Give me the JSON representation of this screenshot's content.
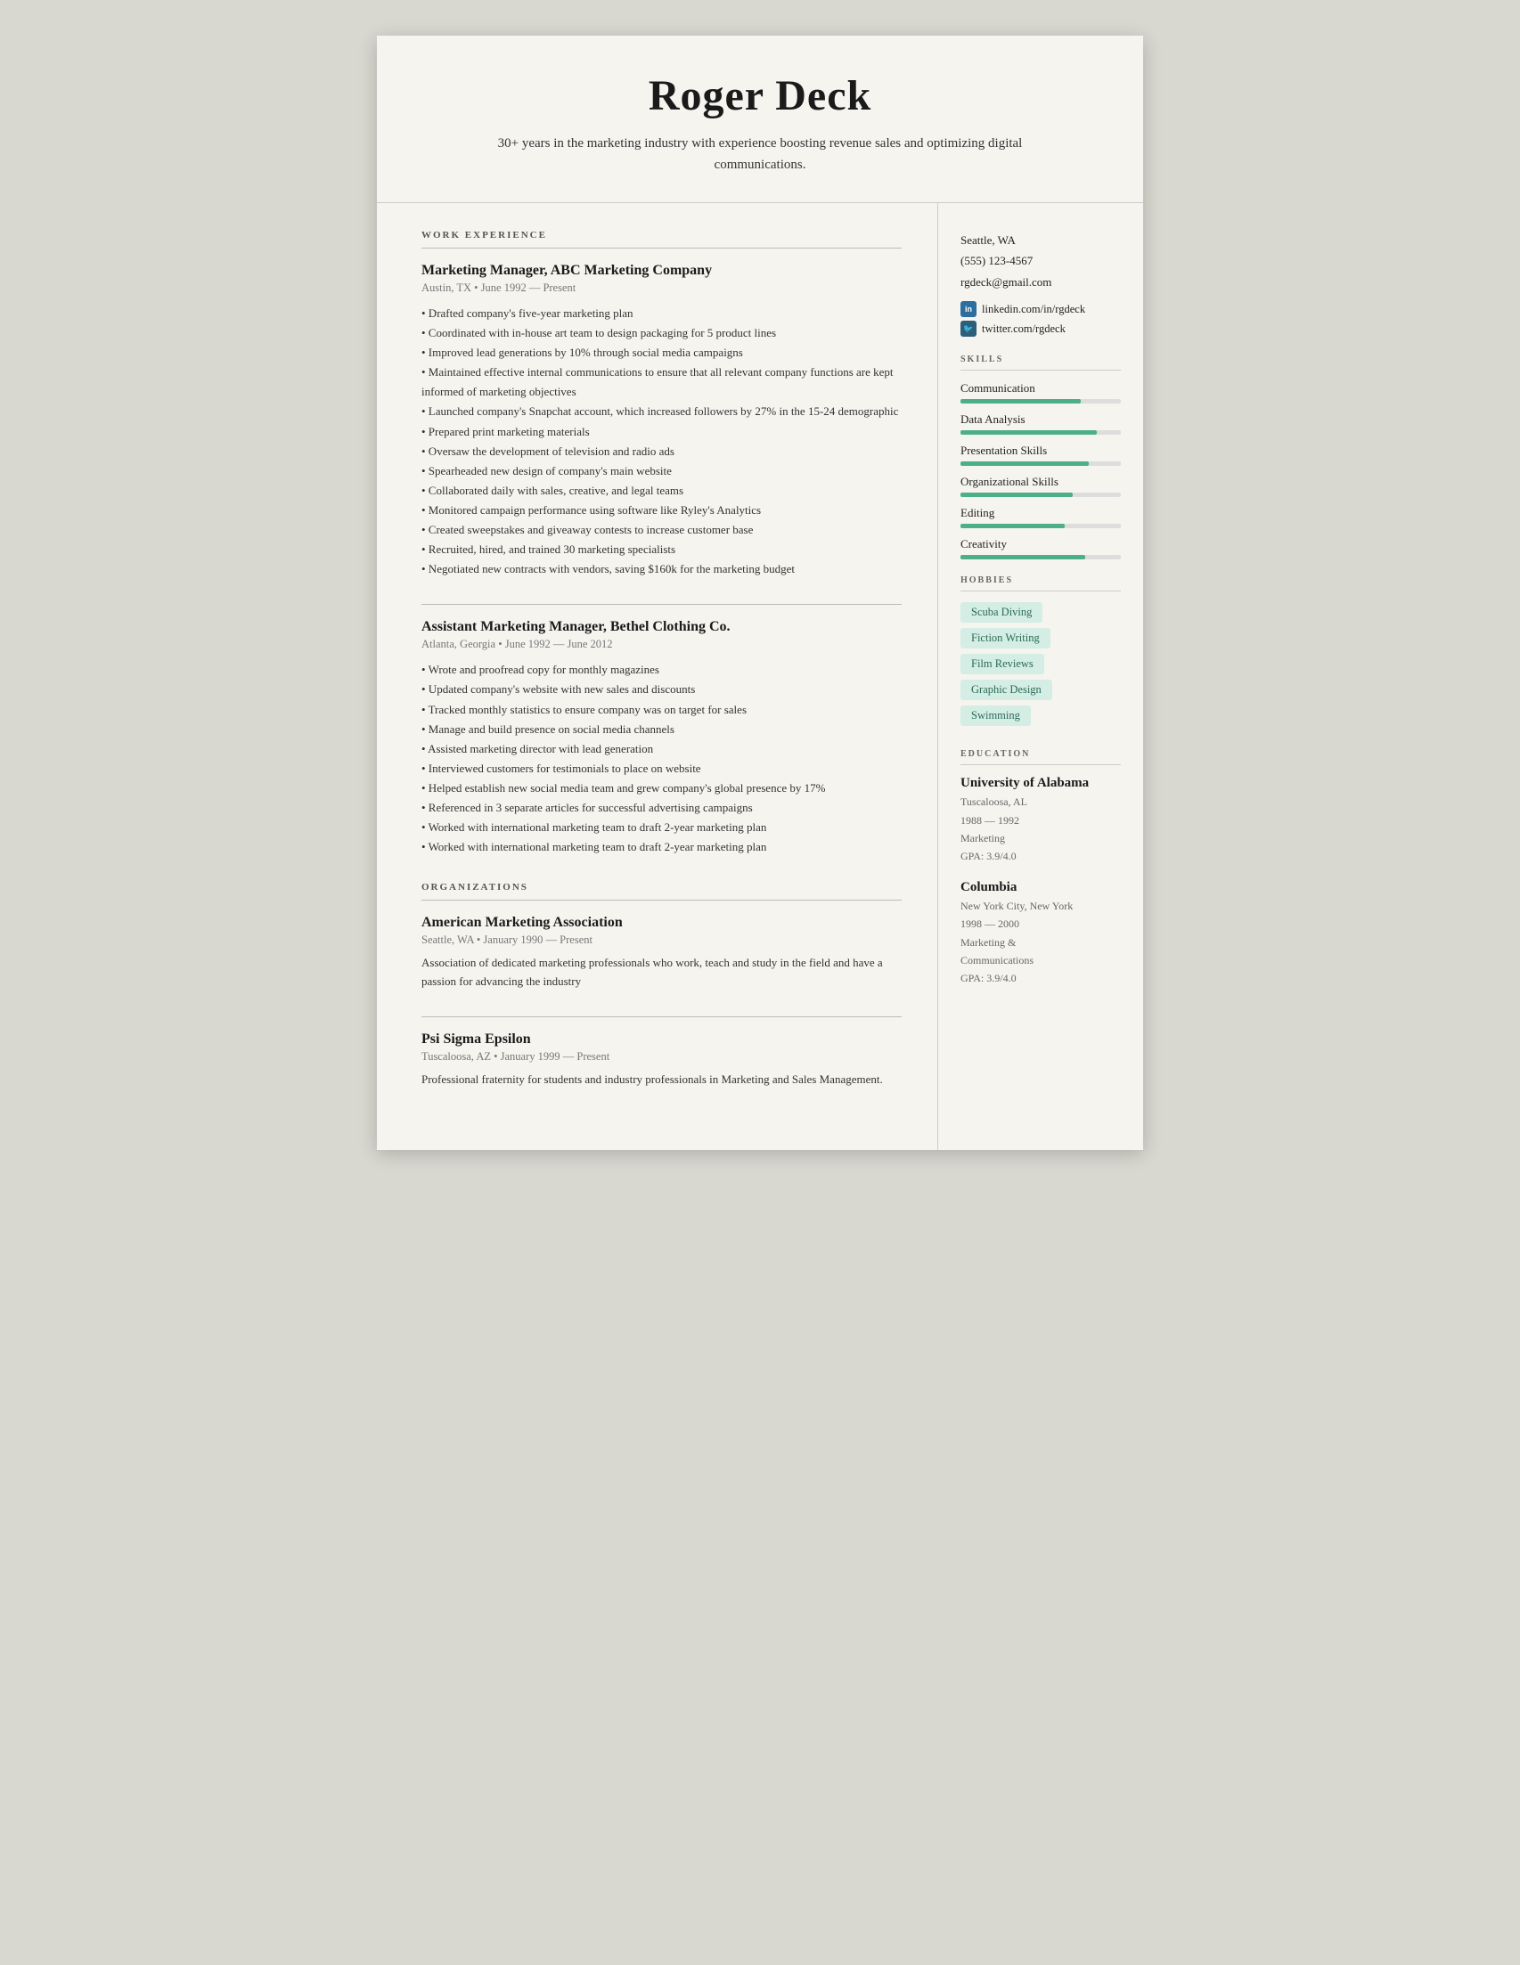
{
  "header": {
    "name": "Roger Deck",
    "subtitle": "30+ years in the marketing industry with experience boosting revenue sales and optimizing digital communications."
  },
  "sidebar": {
    "location": "Seattle, WA",
    "phone": "(555) 123-4567",
    "email": "rgdeck@gmail.com",
    "linkedin": "linkedin.com/in/rgdeck",
    "twitter": "twitter.com/rgdeck",
    "skills_label": "SKILLS",
    "skills": [
      {
        "name": "Communication",
        "pct": 75
      },
      {
        "name": "Data Analysis",
        "pct": 85
      },
      {
        "name": "Presentation Skills",
        "pct": 80
      },
      {
        "name": "Organizational Skills",
        "pct": 70
      },
      {
        "name": "Editing",
        "pct": 65
      },
      {
        "name": "Creativity",
        "pct": 78
      }
    ],
    "hobbies_label": "HOBBIES",
    "hobbies": [
      "Scuba Diving",
      "Fiction Writing",
      "Film Reviews",
      "Graphic Design",
      "Swimming"
    ],
    "education_label": "EDUCATION",
    "education": [
      {
        "school": "University of Alabama",
        "location": "Tuscaloosa, AL",
        "years": "1988 — 1992",
        "degree": "Marketing",
        "gpa": "GPA: 3.9/4.0"
      },
      {
        "school": "Columbia",
        "location": "New York City, New York",
        "years": "1998 — 2000",
        "degree": "Marketing &\nCommunications",
        "gpa": "GPA: 3.9/4.0"
      }
    ]
  },
  "main": {
    "work_label": "WORK EXPERIENCE",
    "jobs": [
      {
        "title": "Marketing Manager, ABC Marketing Company",
        "meta": "Austin, TX • June 1992 — Present",
        "bullets": [
          "Drafted company's five-year marketing plan",
          "Coordinated with in-house art team to design packaging for 5 product lines",
          "Improved lead generations by 10% through social media campaigns",
          "Maintained effective internal communications to ensure that all relevant company functions are kept informed of marketing objectives",
          "Launched company's Snapchat account, which increased followers by 27% in the 15-24 demographic",
          "Prepared print marketing materials",
          "Oversaw the development of television and radio ads",
          "Spearheaded new design of company's main website",
          "Collaborated daily with sales, creative, and legal teams",
          "Monitored campaign performance using software like Ryley's Analytics",
          "Created sweepstakes and giveaway contests to increase customer base",
          "Recruited, hired, and trained 30 marketing specialists",
          "Negotiated new contracts with vendors, saving $160k for the marketing budget"
        ]
      },
      {
        "title": "Assistant Marketing Manager, Bethel Clothing Co.",
        "meta": "Atlanta, Georgia • June 1992 — June 2012",
        "bullets": [
          "Wrote and proofread copy for monthly magazines",
          "Updated company's website with new sales and discounts",
          "Tracked monthly statistics to ensure company was on target for sales",
          "Manage and build presence on social media channels",
          "Assisted marketing director with lead generation",
          "Interviewed customers for testimonials to place on website",
          "Helped establish new social media team and grew company's global presence by 17%",
          "Referenced in 3 separate articles for successful advertising campaigns",
          "Worked with international marketing team to draft 2-year marketing plan",
          "Worked with international marketing team to draft 2-year marketing plan"
        ]
      }
    ],
    "orgs_label": "ORGANIZATIONS",
    "orgs": [
      {
        "name": "American Marketing Association",
        "meta": "Seattle, WA • January 1990 — Present",
        "desc": "Association of dedicated marketing professionals who work, teach and study in the field and have a passion for advancing the industry"
      },
      {
        "name": "Psi Sigma Epsilon",
        "meta": "Tuscaloosa, AZ • January 1999 — Present",
        "desc": "Professional fraternity for students and industry professionals in Marketing and Sales Management."
      }
    ]
  }
}
